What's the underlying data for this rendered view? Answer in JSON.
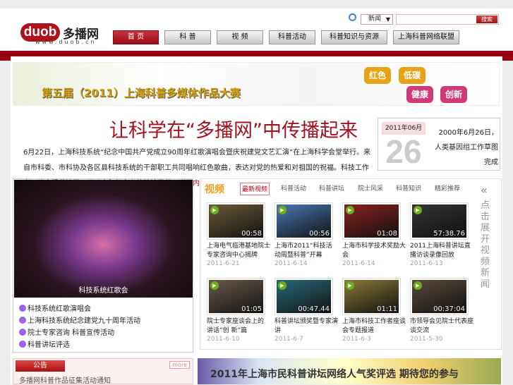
{
  "logo": {
    "bubble": "duob",
    "name": "多播网",
    "url": "www.duob.cn"
  },
  "search": {
    "scope": "新闻",
    "button": "搜索",
    "placeholder": ""
  },
  "nav": [
    "首 页",
    "科 普",
    "视 频",
    "科普活动",
    "科普知识与资源",
    "上海科普网络联盟"
  ],
  "banner": {
    "title": "第五届（2011）上海科普多媒体作品大赛",
    "tags": [
      "红色",
      "低碳",
      "健康",
      "创新"
    ],
    "tag_colors": [
      "#e6a319",
      "#e6a319",
      "#d13a7a",
      "#d13a7a"
    ]
  },
  "headline": "让科学在“多播网”中传播起来",
  "paragraph": {
    "text": "6月22日，上海科技系统“纪念中国共产党成立90周年红歌演唱会暨庆祝建党文艺汇演”在上海科学会堂举行。来自市科委、市科协及各区县科技系统的干部职工共同唱响红色歌曲，表达对党的热爱和对祖国的祝福。科技工作者用歌声抒发情怀，展现出积极向上的精神风貌，",
    "link": "详细内容"
  },
  "today": {
    "year_month": "2011年06月",
    "day": "26",
    "text": "2000年6月26日，人类基因组工作草图完成"
  },
  "photo_caption": "科技系统红歌会",
  "left_list": [
    "科技系统红歌演唱会",
    "上海科技系统纪念建党九十周年活动",
    "院士专家咨询 科普宣传活动",
    "科普讲坛评选"
  ],
  "video": {
    "title": "视频",
    "tabs": [
      "最新视频",
      "科普活动",
      "科普讲坛",
      "院士风采",
      "科普知识",
      "精彩推荐"
    ],
    "side": "点击展开视频新闻",
    "expand": "«",
    "items": [
      {
        "title": "上海电气临港基地院士专家咨询中心揭牌",
        "date": "2011-6-21",
        "duration": "00:58",
        "color": "#6b5a3a"
      },
      {
        "title": "上海市2011“科技活动周暨科普”开幕",
        "date": "2011-6-14",
        "duration": "00:56",
        "color": "#4a78b5"
      },
      {
        "title": "上海市科学技术奖励大会",
        "date": "2011-6-14",
        "duration": "01:08",
        "color": "#8a2020"
      },
      {
        "title": "2011上海科普讲坛直播访谈录像回放",
        "date": "2011-6-13",
        "duration": "57:38.76",
        "color": "#333"
      },
      {
        "title": "院士专家座谈会上的 讲话“创 新”篇",
        "date": "2011-6-10",
        "duration": "01:05",
        "color": "#6a5a4a"
      },
      {
        "title": "科普讲坛颁奖暨专家演讲",
        "date": "2011-6-7",
        "duration": "00:47.44",
        "color": "#2a6a7a"
      },
      {
        "title": "上海市科技工作者座谈会专题报道",
        "date": "2011-6-3",
        "duration": "01:11",
        "color": "#8a7a3a"
      },
      {
        "title": "市领导会见院士代表座谈交流",
        "date": "2011-5-30",
        "duration": "00:37:04",
        "color": "#5a4a3a"
      }
    ]
  },
  "notice": {
    "title": "公告",
    "more": "more",
    "first": "多播网科普作品征集活动通知"
  },
  "bottom_banner": "2011年上海市民科普讲坛网络人气奖评选  期待您的参与"
}
